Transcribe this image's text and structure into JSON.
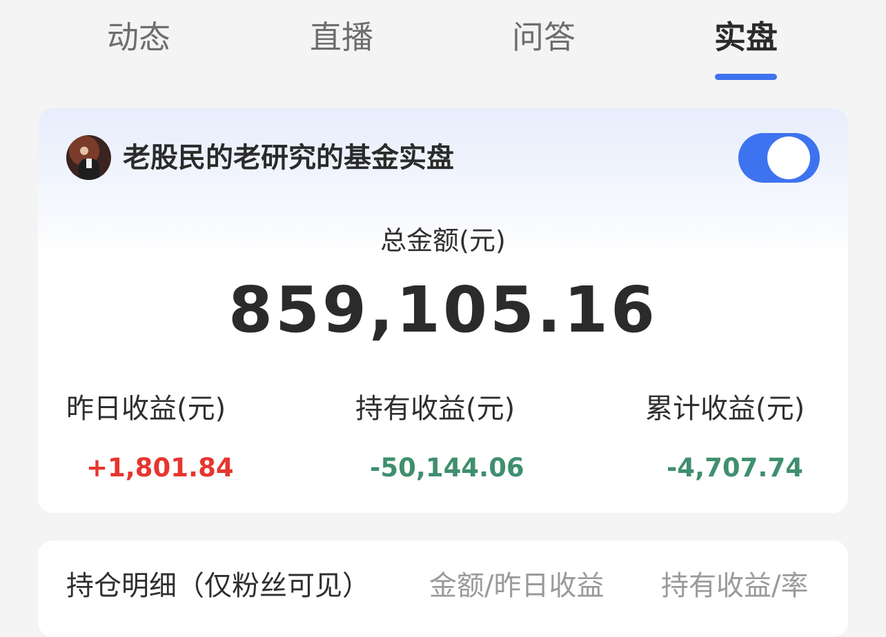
{
  "tabs": [
    {
      "label": "动态",
      "active": false
    },
    {
      "label": "直播",
      "active": false
    },
    {
      "label": "问答",
      "active": false
    },
    {
      "label": "实盘",
      "active": true
    }
  ],
  "portfolio": {
    "title": "老股民的老研究的基金实盘",
    "toggle_on": true,
    "accent_color": "#3e73f0"
  },
  "summary": {
    "total_label": "总金额(元)",
    "total_value": "859,105.16"
  },
  "stats": [
    {
      "label": "昨日收益(元)",
      "value": "+1,801.84",
      "color": "#e5362f"
    },
    {
      "label": "持有收益(元)",
      "value": "-50,144.06",
      "color": "#3f8f6f"
    },
    {
      "label": "累计收益(元)",
      "value": "-4,707.74",
      "color": "#3f8f6f"
    }
  ],
  "holdings": {
    "title": "持仓明细（仅粉丝可见）",
    "col_amount": "金额/昨日收益",
    "col_return": "持有收益/率"
  }
}
